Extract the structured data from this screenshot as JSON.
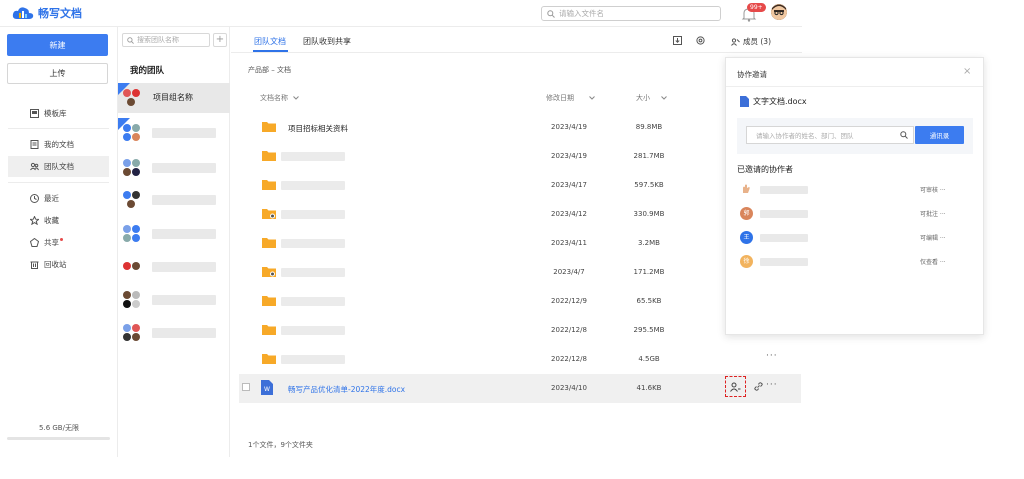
{
  "app": {
    "name": "畅写文档",
    "brand_color": "#2f73e8",
    "search_placeholder": "请输入文件名",
    "notification_count": "99+"
  },
  "sidebar": {
    "new_label": "新建",
    "upload_label": "上传",
    "items": [
      {
        "label": "模板库",
        "icon": "template-icon"
      },
      {
        "label": "我的文档",
        "icon": "document-icon"
      },
      {
        "label": "团队文档",
        "icon": "team-icon",
        "active": true
      },
      {
        "label": "最近",
        "icon": "clock-icon"
      },
      {
        "label": "收藏",
        "icon": "star-icon"
      },
      {
        "label": "共享",
        "icon": "share-icon",
        "dot": true
      },
      {
        "label": "回收站",
        "icon": "trash-icon"
      }
    ],
    "storage": "5.6 GB/无限"
  },
  "teams": {
    "search_placeholder": "搜索团队名称",
    "add_label": "+",
    "title": "我的团队",
    "first_team_name": "项目组名称"
  },
  "main": {
    "tabs": [
      "团队文档",
      "团队收到共享"
    ],
    "members_label": "成员 (3)",
    "breadcrumb": "产品部 – 文档",
    "columns": {
      "name": "文档名称",
      "date": "修改日期",
      "size": "大小"
    },
    "rows": [
      {
        "name": "项目招标相关资料",
        "date": "2023/4/19",
        "size": "89.8MB"
      },
      {
        "name": "",
        "date": "2023/4/19",
        "size": "281.7MB"
      },
      {
        "name": "",
        "date": "2023/4/17",
        "size": "597.5KB"
      },
      {
        "name": "",
        "date": "2023/4/12",
        "size": "330.9MB"
      },
      {
        "name": "",
        "date": "2023/4/11",
        "size": "3.2MB"
      },
      {
        "name": "",
        "date": "2023/4/7",
        "size": "171.2MB"
      },
      {
        "name": "",
        "date": "2022/12/9",
        "size": "65.5KB"
      },
      {
        "name": "",
        "date": "2022/12/8",
        "size": "295.5MB"
      },
      {
        "name": "",
        "date": "2022/12/8",
        "size": "4.5GB"
      }
    ],
    "file_row": {
      "name": "畅写产品优化清单-2022年度.docx",
      "date": "2023/4/10",
      "size": "41.6KB"
    },
    "more_label": "···",
    "summary": "1个文件，9个文件夹"
  },
  "invite": {
    "title": "协作邀请",
    "close": "×",
    "doc_name": "文字文档.docx",
    "input_placeholder": "请输入协作者的姓名、部门、团队",
    "address_book": "通讯录",
    "invited_title": "已邀请的协作者",
    "collaborators": [
      {
        "avatar_text": "",
        "role": "可审核 ···"
      },
      {
        "avatar_text": "郭",
        "role": "可批注 ···"
      },
      {
        "avatar_text": "王",
        "role": "可编辑 ···"
      },
      {
        "avatar_text": "徐",
        "role": "仅查看 ···"
      }
    ]
  }
}
